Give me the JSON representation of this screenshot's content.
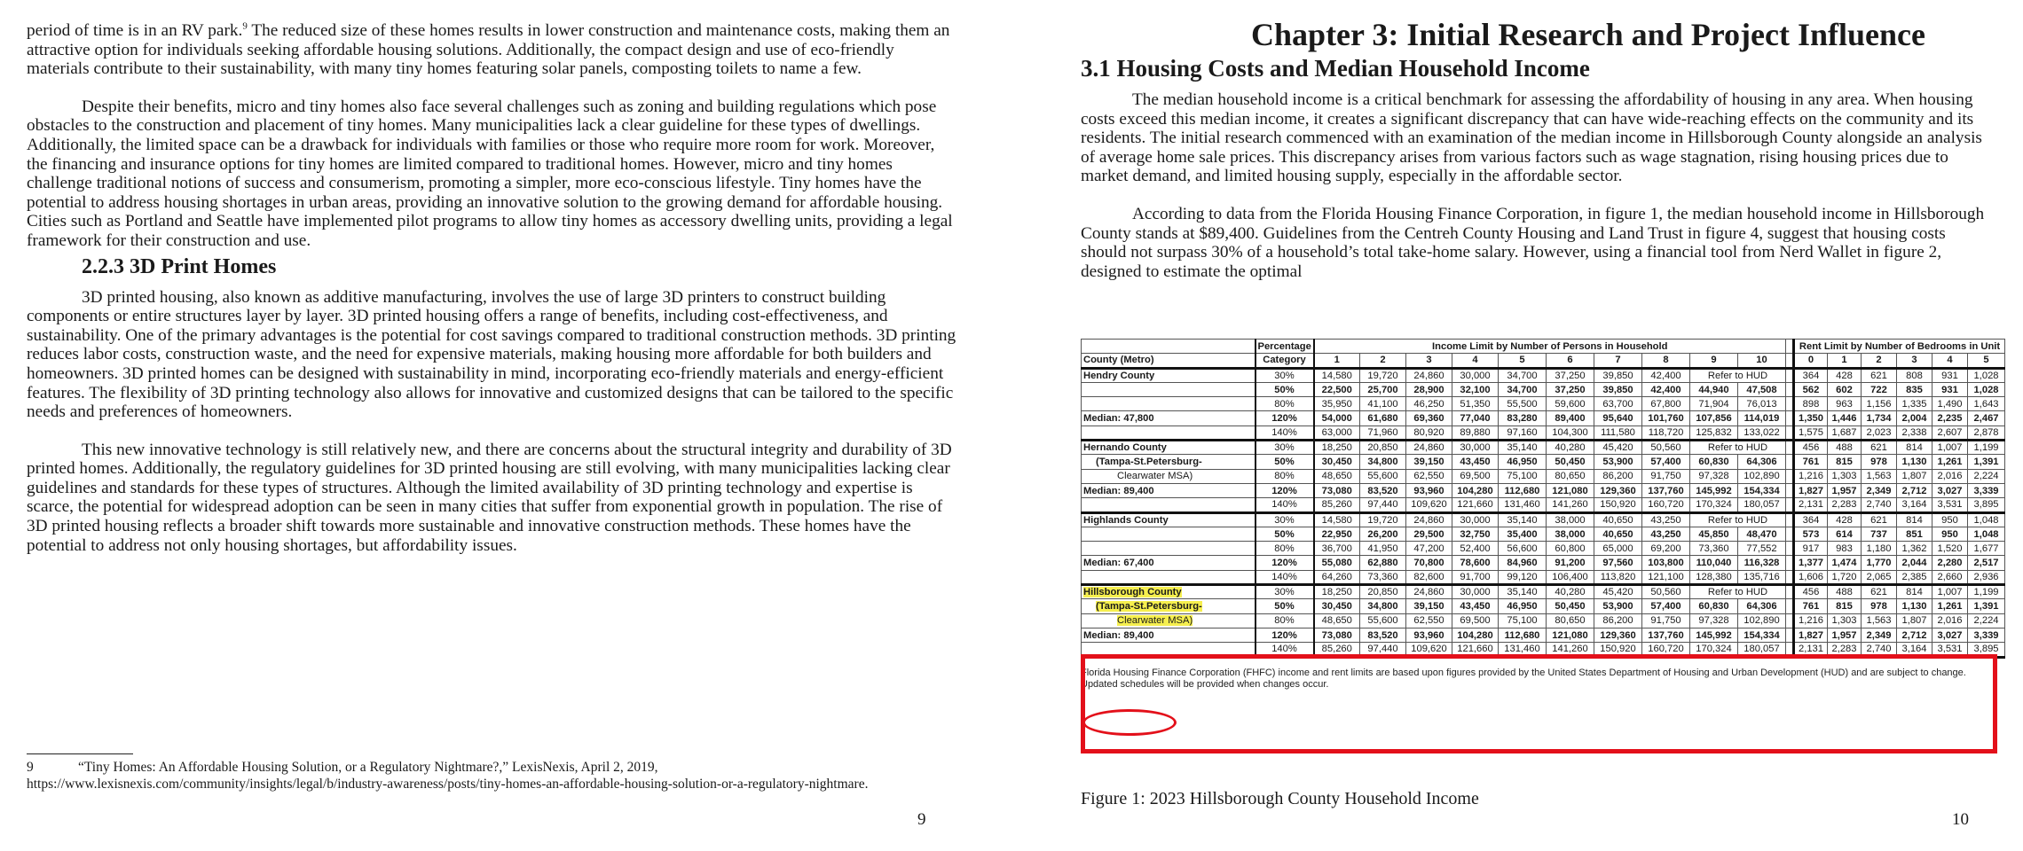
{
  "left_page": {
    "paragraphs": [
      "period of time is in an RV park.",
      "The reduced size of these homes results in lower construction and maintenance costs, making them an attractive option for individuals seeking affordable housing solutions. Additionally, the compact design and use of eco-friendly materials contribute to their sustainability, with many tiny homes featuring solar panels, composting toilets to name a few.",
      "Despite their benefits, micro and tiny homes also face several challenges such as zoning and building regulations which pose obstacles to the construction and placement of tiny homes. Many municipalities lack a clear guideline for these types of dwellings. Additionally, the limited space can be a drawback for individuals with families or those who require more room for work. Moreover, the financing and insurance options for tiny homes are limited compared to traditional homes. However, micro and tiny homes challenge traditional notions of success and consumerism, promoting a simpler, more eco-conscious lifestyle. Tiny homes have the potential to address housing shortages in urban areas, providing an innovative solution to the growing demand for affordable housing. Cities such as Portland and Seattle have implemented pilot programs to allow tiny homes as accessory dwelling units, providing a legal framework for their construction and use.",
      "3D printed housing, also known as additive manufacturing, involves the use of large 3D printers to construct building components or entire structures layer by layer. 3D printed housing offers a range of benefits, including cost-effectiveness, and sustainability. One of the primary advantages is the potential for cost savings compared to traditional construction methods. 3D printing reduces labor costs, construction waste, and the need for expensive materials, making housing more affordable for both builders and homeowners. 3D printed homes can be designed with sustainability in mind, incorporating eco-friendly materials and energy-efficient features. The flexibility of 3D printing technology also allows for innovative and customized designs that can be tailored to the specific needs and preferences of homeowners.",
      "This new innovative technology is still relatively new, and there are concerns about the structural integrity and durability of 3D printed homes. Additionally, the regulatory guidelines for 3D printed housing are still evolving, with many municipalities lacking clear guidelines and standards for these types of structures. Although the limited availability of 3D printing technology and expertise is scarce, the potential for widespread adoption can be seen in many cities that suffer from exponential growth in population. The rise of 3D printed housing reflects a broader shift towards more sustainable and innovative construction methods. These homes have the potential to address not only housing shortages, but affordability issues."
    ],
    "footnote_ref": "9",
    "heading": "2.2.3 3D Print Homes",
    "footnote_num": "9",
    "footnote_text": "“Tiny Homes: An Affordable Housing Solution, or a Regulatory Nightmare?,” LexisNexis, April 2, 2019, https://www.lexisnexis.com/community/insights/legal/b/industry-awareness/posts/tiny-homes-an-affordable-housing-solution-or-a-regulatory-nightmare.",
    "page_number": "9"
  },
  "right_page": {
    "chapter_title": "Chapter 3: Initial Research and Project Influence",
    "section_title": "3.1 Housing Costs and Median Household Income",
    "paragraphs": [
      "The median household income is a critical benchmark for assessing the affordability of housing in any area. When housing costs exceed this median income, it creates a significant discrepancy that can have wide-reaching effects on the community and its residents. The initial research commenced with an examination of the median income in Hillsborough County alongside an analysis of average home sale prices. This discrepancy arises from various factors such as wage stagnation, rising housing prices due to market demand, and limited housing supply, especially in the affordable sector.",
      "According to data from the Florida Housing Finance Corporation, in figure 1, the median household income in Hillsborough County stands at $89,400. Guidelines from the Centreh County Housing and Land Trust in figure 4, suggest that housing costs should not surpass 30% of a household’s total take-home salary. However, using a financial tool from Nerd Wallet in figure 2, designed to estimate the optimal"
    ],
    "table": {
      "header_top": {
        "percentage": "Percentage",
        "income_group": "Income Limit by Number of Persons in Household",
        "rent_group": "Rent Limit by Number of Bedrooms in Unit"
      },
      "header": {
        "county": "County (Metro)",
        "category": "Category",
        "persons": [
          "1",
          "2",
          "3",
          "4",
          "5",
          "6",
          "7",
          "8",
          "9",
          "10"
        ],
        "bedrooms": [
          "0",
          "1",
          "2",
          "3",
          "4",
          "5"
        ]
      },
      "blocks": [
        {
          "rows": [
            {
              "label": "Hendry County",
              "pct": "30%",
              "income": [
                "14,580",
                "19,720",
                "24,860",
                "30,000",
                "34,700",
                "37,250",
                "39,850",
                "42,400"
              ],
              "hud": "Refer to HUD",
              "rent": [
                "364",
                "428",
                "621",
                "808",
                "931",
                "1,028"
              ]
            },
            {
              "label": "",
              "pct": "50%",
              "income": [
                "22,500",
                "25,700",
                "28,900",
                "32,100",
                "34,700",
                "37,250",
                "39,850",
                "42,400",
                "44,940",
                "47,508"
              ],
              "rent": [
                "562",
                "602",
                "722",
                "835",
                "931",
                "1,028"
              ]
            },
            {
              "label": "",
              "pct": "80%",
              "income": [
                "35,950",
                "41,100",
                "46,250",
                "51,350",
                "55,500",
                "59,600",
                "63,700",
                "67,800",
                "71,904",
                "76,013"
              ],
              "rent": [
                "898",
                "963",
                "1,156",
                "1,335",
                "1,490",
                "1,643"
              ]
            },
            {
              "label": "Median:     47,800",
              "pct": "120%",
              "income": [
                "54,000",
                "61,680",
                "69,360",
                "77,040",
                "83,280",
                "89,400",
                "95,640",
                "101,760",
                "107,856",
                "114,019"
              ],
              "rent": [
                "1,350",
                "1,446",
                "1,734",
                "2,004",
                "2,235",
                "2,467"
              ]
            },
            {
              "label": "",
              "pct": "140%",
              "income": [
                "63,000",
                "71,960",
                "80,920",
                "89,880",
                "97,160",
                "104,300",
                "111,580",
                "118,720",
                "125,832",
                "133,022"
              ],
              "rent": [
                "1,575",
                "1,687",
                "2,023",
                "2,338",
                "2,607",
                "2,878"
              ]
            }
          ]
        },
        {
          "rows": [
            {
              "label": "Hernando County",
              "pct": "30%",
              "income": [
                "18,250",
                "20,850",
                "24,860",
                "30,000",
                "35,140",
                "40,280",
                "45,420",
                "50,560"
              ],
              "hud": "Refer to HUD",
              "rent": [
                "456",
                "488",
                "621",
                "814",
                "1,007",
                "1,199"
              ]
            },
            {
              "label": "(Tampa-St.Petersburg-",
              "pct": "50%",
              "income": [
                "30,450",
                "34,800",
                "39,150",
                "43,450",
                "46,950",
                "50,450",
                "53,900",
                "57,400",
                "60,830",
                "64,306"
              ],
              "rent": [
                "761",
                "815",
                "978",
                "1,130",
                "1,261",
                "1,391"
              ]
            },
            {
              "label": "Clearwater MSA)",
              "pct": "80%",
              "income": [
                "48,650",
                "55,600",
                "62,550",
                "69,500",
                "75,100",
                "80,650",
                "86,200",
                "91,750",
                "97,328",
                "102,890"
              ],
              "rent": [
                "1,216",
                "1,303",
                "1,563",
                "1,807",
                "2,016",
                "2,224"
              ]
            },
            {
              "label": "Median:     89,400",
              "pct": "120%",
              "income": [
                "73,080",
                "83,520",
                "93,960",
                "104,280",
                "112,680",
                "121,080",
                "129,360",
                "137,760",
                "145,992",
                "154,334"
              ],
              "rent": [
                "1,827",
                "1,957",
                "2,349",
                "2,712",
                "3,027",
                "3,339"
              ]
            },
            {
              "label": "",
              "pct": "140%",
              "income": [
                "85,260",
                "97,440",
                "109,620",
                "121,660",
                "131,460",
                "141,260",
                "150,920",
                "160,720",
                "170,324",
                "180,057"
              ],
              "rent": [
                "2,131",
                "2,283",
                "2,740",
                "3,164",
                "3,531",
                "3,895"
              ]
            }
          ]
        },
        {
          "rows": [
            {
              "label": "Highlands County",
              "pct": "30%",
              "income": [
                "14,580",
                "19,720",
                "24,860",
                "30,000",
                "35,140",
                "38,000",
                "40,650",
                "43,250"
              ],
              "hud": "Refer to HUD",
              "rent": [
                "364",
                "428",
                "621",
                "814",
                "950",
                "1,048"
              ]
            },
            {
              "label": "",
              "pct": "50%",
              "income": [
                "22,950",
                "26,200",
                "29,500",
                "32,750",
                "35,400",
                "38,000",
                "40,650",
                "43,250",
                "45,850",
                "48,470"
              ],
              "rent": [
                "573",
                "614",
                "737",
                "851",
                "950",
                "1,048"
              ]
            },
            {
              "label": "",
              "pct": "80%",
              "income": [
                "36,700",
                "41,950",
                "47,200",
                "52,400",
                "56,600",
                "60,800",
                "65,000",
                "69,200",
                "73,360",
                "77,552"
              ],
              "rent": [
                "917",
                "983",
                "1,180",
                "1,362",
                "1,520",
                "1,677"
              ]
            },
            {
              "label": "Median:     67,400",
              "pct": "120%",
              "income": [
                "55,080",
                "62,880",
                "70,800",
                "78,600",
                "84,960",
                "91,200",
                "97,560",
                "103,800",
                "110,040",
                "116,328"
              ],
              "rent": [
                "1,377",
                "1,474",
                "1,770",
                "2,044",
                "2,280",
                "2,517"
              ]
            },
            {
              "label": "",
              "pct": "140%",
              "income": [
                "64,260",
                "73,360",
                "82,600",
                "91,700",
                "99,120",
                "106,400",
                "113,820",
                "121,100",
                "128,380",
                "135,716"
              ],
              "rent": [
                "1,606",
                "1,720",
                "2,065",
                "2,385",
                "2,660",
                "2,936"
              ]
            }
          ]
        },
        {
          "rows": [
            {
              "label": "Hillsborough County",
              "pct": "30%",
              "income": [
                "18,250",
                "20,850",
                "24,860",
                "30,000",
                "35,140",
                "40,280",
                "45,420",
                "50,560"
              ],
              "hud": "Refer to HUD",
              "rent": [
                "456",
                "488",
                "621",
                "814",
                "1,007",
                "1,199"
              ]
            },
            {
              "label": "(Tampa-St.Petersburg-",
              "pct": "50%",
              "income": [
                "30,450",
                "34,800",
                "39,150",
                "43,450",
                "46,950",
                "50,450",
                "53,900",
                "57,400",
                "60,830",
                "64,306"
              ],
              "rent": [
                "761",
                "815",
                "978",
                "1,130",
                "1,261",
                "1,391"
              ]
            },
            {
              "label": "Clearwater MSA)",
              "pct": "80%",
              "income": [
                "48,650",
                "55,600",
                "62,550",
                "69,500",
                "75,100",
                "80,650",
                "86,200",
                "91,750",
                "97,328",
                "102,890"
              ],
              "rent": [
                "1,216",
                "1,303",
                "1,563",
                "1,807",
                "2,016",
                "2,224"
              ]
            },
            {
              "label": "Median:     89,400",
              "pct": "120%",
              "income": [
                "73,080",
                "83,520",
                "93,960",
                "104,280",
                "112,680",
                "121,080",
                "129,360",
                "137,760",
                "145,992",
                "154,334"
              ],
              "rent": [
                "1,827",
                "1,957",
                "2,349",
                "2,712",
                "3,027",
                "3,339"
              ]
            },
            {
              "label": "",
              "pct": "140%",
              "income": [
                "85,260",
                "97,440",
                "109,620",
                "121,660",
                "131,460",
                "141,260",
                "150,920",
                "160,720",
                "170,324",
                "180,057"
              ],
              "rent": [
                "2,131",
                "2,283",
                "2,740",
                "3,164",
                "3,531",
                "3,895"
              ]
            }
          ]
        }
      ],
      "note": "Florida Housing Finance Corporation (FHFC) income and rent limits are based upon figures provided by the United States Department of Housing and Urban Development (HUD) and are subject to change.  Updated schedules will be provided when changes occur.",
      "highlight_color": "#f6ef4e",
      "annotation_color": "#e3101a"
    },
    "figure_caption": "Figure 1: 2023 Hillsborough County Household Income",
    "page_number": "10"
  }
}
